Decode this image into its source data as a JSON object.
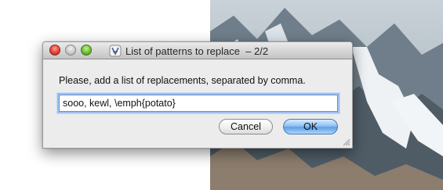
{
  "window": {
    "title": "List of patterns to replace  – 2/2"
  },
  "dialog": {
    "prompt": "Please, add a list of replacements, separated by comma.",
    "input_value": "sooo, kewl, \\emph{potato}"
  },
  "buttons": {
    "cancel_label": "Cancel",
    "ok_label": "OK"
  },
  "colors": {
    "ok_accent": "#5e9fe2",
    "focus_ring": "#9fc0ef",
    "close": "#e0443a",
    "zoom": "#6bbf34"
  },
  "icons": {
    "window_controls": [
      "close-icon",
      "minimize-icon",
      "zoom-icon"
    ],
    "title": "app-icon",
    "resize": "resize-grip-icon"
  }
}
